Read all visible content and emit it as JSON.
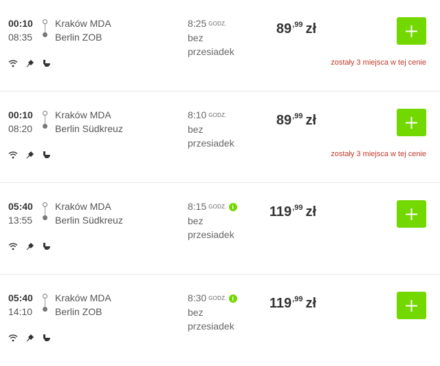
{
  "colors": {
    "accent": "#73d700",
    "warning": "#c0392b"
  },
  "connections": [
    {
      "departure_time": "00:10",
      "arrival_time": "08:35",
      "from": "Kraków MDA",
      "to": "Berlin ZOB",
      "duration": "8:25",
      "duration_unit": "GODZ.",
      "transfers_line1": "bez",
      "transfers_line2": "przesiadek",
      "price_main": "89",
      "price_decimal": ",99",
      "currency": "zł",
      "seats_warning": "zostały 3 miejsca w tej cenie",
      "info_icon": "",
      "amenities": [
        "wifi-icon",
        "power-plug-icon",
        "toilet-icon"
      ]
    },
    {
      "departure_time": "00:10",
      "arrival_time": "08:20",
      "from": "Kraków MDA",
      "to": "Berlin Südkreuz",
      "duration": "8:10",
      "duration_unit": "GODZ.",
      "transfers_line1": "bez",
      "transfers_line2": "przesiadek",
      "price_main": "89",
      "price_decimal": ",99",
      "currency": "zł",
      "seats_warning": "zostały 3 miejsca w tej cenie",
      "info_icon": "",
      "amenities": [
        "wifi-icon",
        "power-plug-icon",
        "toilet-icon"
      ]
    },
    {
      "departure_time": "05:40",
      "arrival_time": "13:55",
      "from": "Kraków MDA",
      "to": "Berlin Südkreuz",
      "duration": "8:15",
      "duration_unit": "GODZ.",
      "transfers_line1": "bez",
      "transfers_line2": "przesiadek",
      "price_main": "119",
      "price_decimal": ",99",
      "currency": "zł",
      "seats_warning": "",
      "info_icon": "i",
      "amenities": [
        "wifi-icon",
        "power-plug-icon",
        "toilet-icon"
      ]
    },
    {
      "departure_time": "05:40",
      "arrival_time": "14:10",
      "from": "Kraków MDA",
      "to": "Berlin ZOB",
      "duration": "8:30",
      "duration_unit": "GODZ.",
      "transfers_line1": "bez",
      "transfers_line2": "przesiadek",
      "price_main": "119",
      "price_decimal": ",99",
      "currency": "zł",
      "seats_warning": "",
      "info_icon": "i",
      "amenities": [
        "wifi-icon",
        "power-plug-icon",
        "toilet-icon"
      ]
    }
  ]
}
